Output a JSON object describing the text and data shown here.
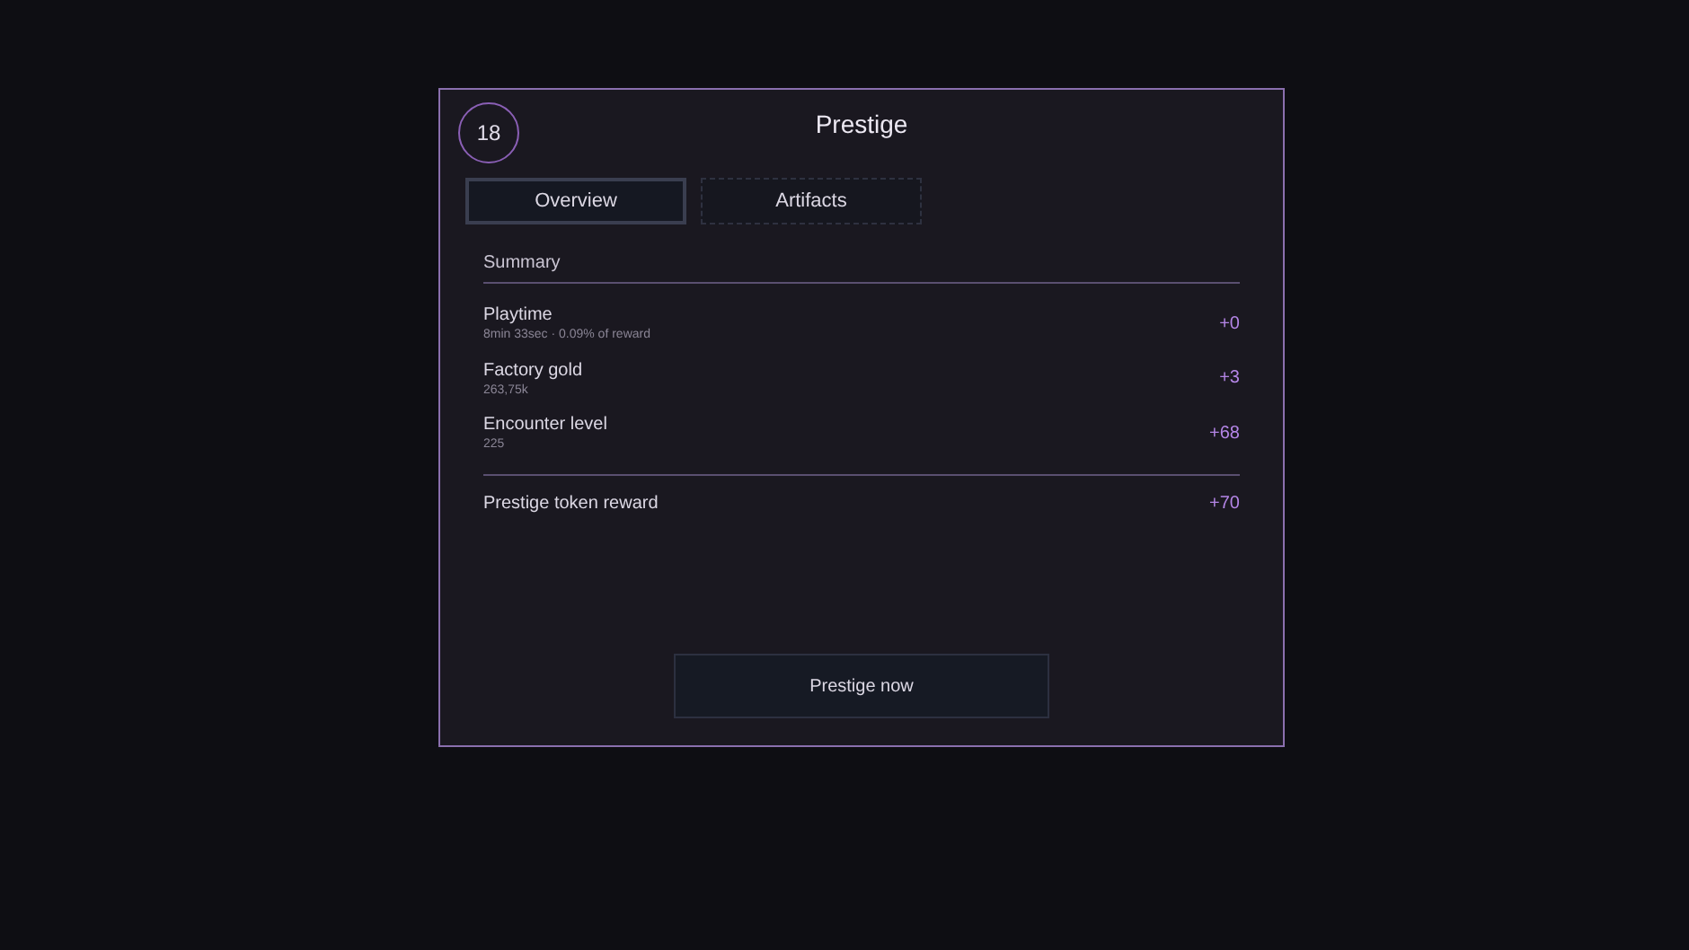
{
  "dialog": {
    "level_badge": "18",
    "title": "Prestige",
    "tabs": [
      {
        "label": "Overview",
        "selected": true
      },
      {
        "label": "Artifacts",
        "selected": false
      }
    ],
    "section_title": "Summary",
    "rows": [
      {
        "label": "Playtime",
        "detail": "8min 33sec · 0.09% of reward",
        "value": "+0"
      },
      {
        "label": "Factory gold",
        "detail": "263,75k",
        "value": "+3"
      },
      {
        "label": "Encounter level",
        "detail": "225",
        "value": "+68"
      }
    ],
    "total": {
      "label": "Prestige token reward",
      "value": "+70"
    },
    "button": "Prestige now"
  }
}
